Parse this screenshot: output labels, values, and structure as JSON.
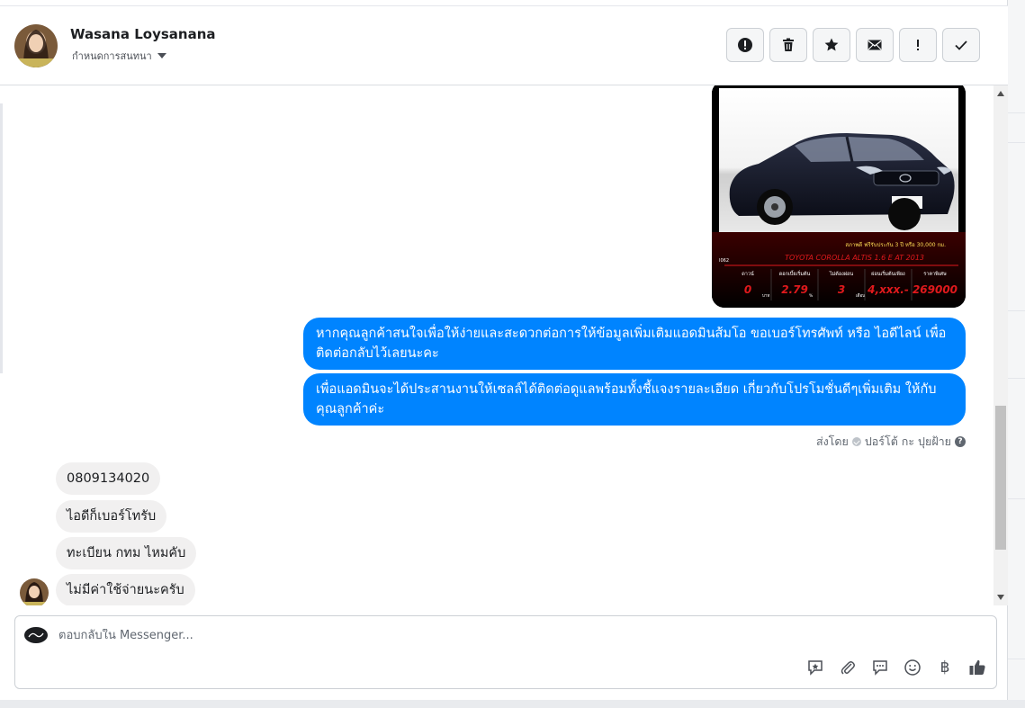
{
  "header": {
    "name": "Wasana Loysanana",
    "conversation_settings_label": "กำหนดการสนทนา",
    "toolbar": [
      {
        "icon": "alert-circle-icon",
        "name": "mark-spam-button"
      },
      {
        "icon": "trash-icon",
        "name": "delete-button"
      },
      {
        "icon": "star-icon",
        "name": "star-button"
      },
      {
        "icon": "envelope-icon",
        "name": "mark-unread-button"
      },
      {
        "icon": "exclamation-icon",
        "name": "priority-button"
      },
      {
        "icon": "check-icon",
        "name": "mark-done-button"
      }
    ]
  },
  "messages": {
    "outgoing": [
      {
        "text": "หากคุณลูกค้าสนใจเพื่อให้ง่ายและสะดวกต่อการให้ข้อมูลเพิ่มเติมแอดมินส้มโอ ขอเบอร์โทรศัพท์ หรือ ไอดีไลน์ เพื่อติดต่อกลับไว้เลยนะคะ"
      },
      {
        "text": "เพื่อแอดมินจะได้ประสานงานให้เซลล์ได้ติดต่อดูแลพร้อมทั้งชี้แจงรายละเอียด เกี่ยวกับโปรโมชั่นดีๆเพิ่มเติม ให้กับคุณลูกค้าค่ะ"
      }
    ],
    "sent_by_label": "ส่งโดย",
    "sent_by_name": "ปอร์โต้ กะ ปุยฝ้าย",
    "incoming": [
      {
        "text": "0809134020"
      },
      {
        "text": "ไอดีก็เบอร์โทรับ"
      },
      {
        "text": "ทะเบียน กทม ไหมคับ"
      },
      {
        "text": "ไม่มีค่าใช้จ่ายนะครับ"
      }
    ]
  },
  "car_ad": {
    "model": "TOYOTA COROLLA ALTIS 1.6 E AT 2013",
    "warranty": "สภาพดี ฟรีรับประกัน 3 ปี หรือ 30,000 กม.",
    "code": "I062",
    "cells": [
      {
        "label": "ดาวน์",
        "value": "0",
        "unit": "บาท"
      },
      {
        "label": "ดอกเบี้ยเริ่มต้น",
        "value": "2.79",
        "unit": "%"
      },
      {
        "label": "ไม่ต้องผ่อน",
        "value": "3",
        "unit": "เดือน"
      },
      {
        "label": "ผ่อนเริ่มต้นเพียง",
        "value": "4,xxx.-",
        "unit": ""
      },
      {
        "label": "ราคาพิเศษ",
        "value": "269000",
        "unit": ""
      }
    ]
  },
  "composer": {
    "placeholder": "ตอบกลับใน Messenger...",
    "tools": [
      "saved-reply-icon",
      "attachment-icon",
      "comment-icon",
      "emoji-icon",
      "baht-icon",
      "thumbs-up-icon"
    ],
    "baht_symbol": "฿"
  },
  "colors": {
    "outgoing_bubble": "#0084ff",
    "incoming_bubble": "#f1f0f0",
    "car_ad_accent": "#e0191c"
  }
}
